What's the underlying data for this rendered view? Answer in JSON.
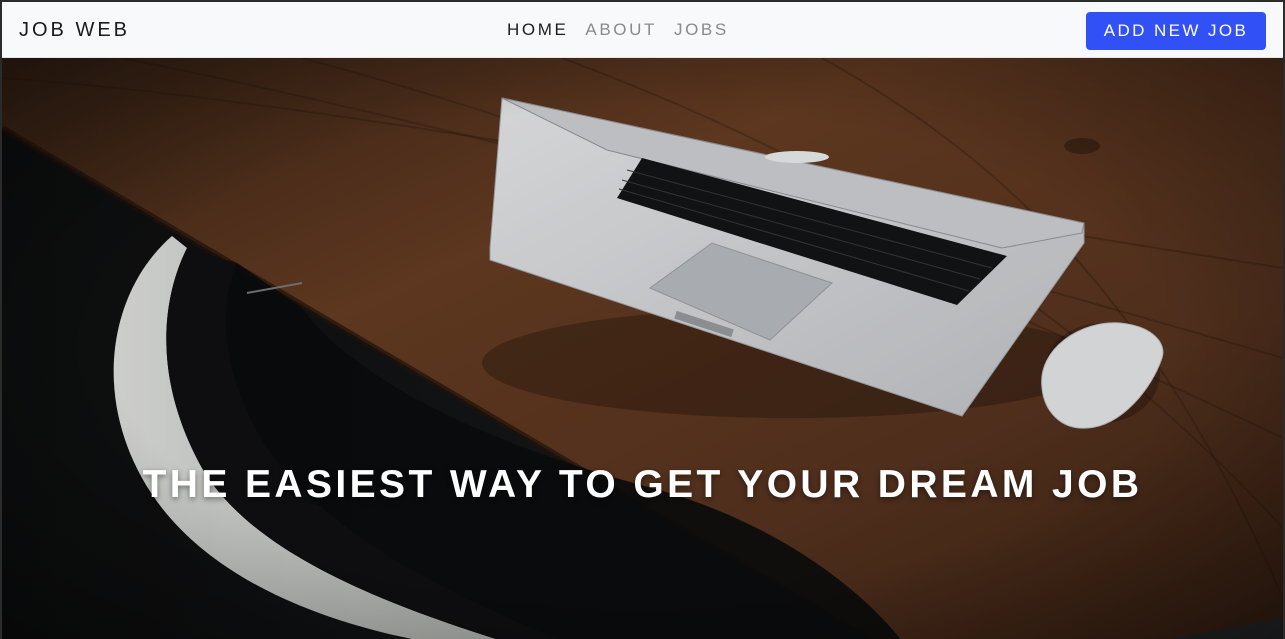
{
  "navbar": {
    "brand": "JOB WEB",
    "links": [
      {
        "label": "HOME",
        "active": true
      },
      {
        "label": "ABOUT",
        "active": false
      },
      {
        "label": "JOBS",
        "active": false
      }
    ],
    "cta_label": "ADD NEW JOB"
  },
  "hero": {
    "title": "THE EASIEST WAY TO GET YOUR DREAM JOB"
  },
  "colors": {
    "accent": "#3150f5",
    "navbar_bg": "#f8f9fb",
    "wood": "#5a3520",
    "text_dark": "#1b1b1b",
    "text_muted": "#8a8a8a"
  },
  "icons": [
    "laptop-illustration",
    "mouse-illustration",
    "chair-illustration"
  ]
}
